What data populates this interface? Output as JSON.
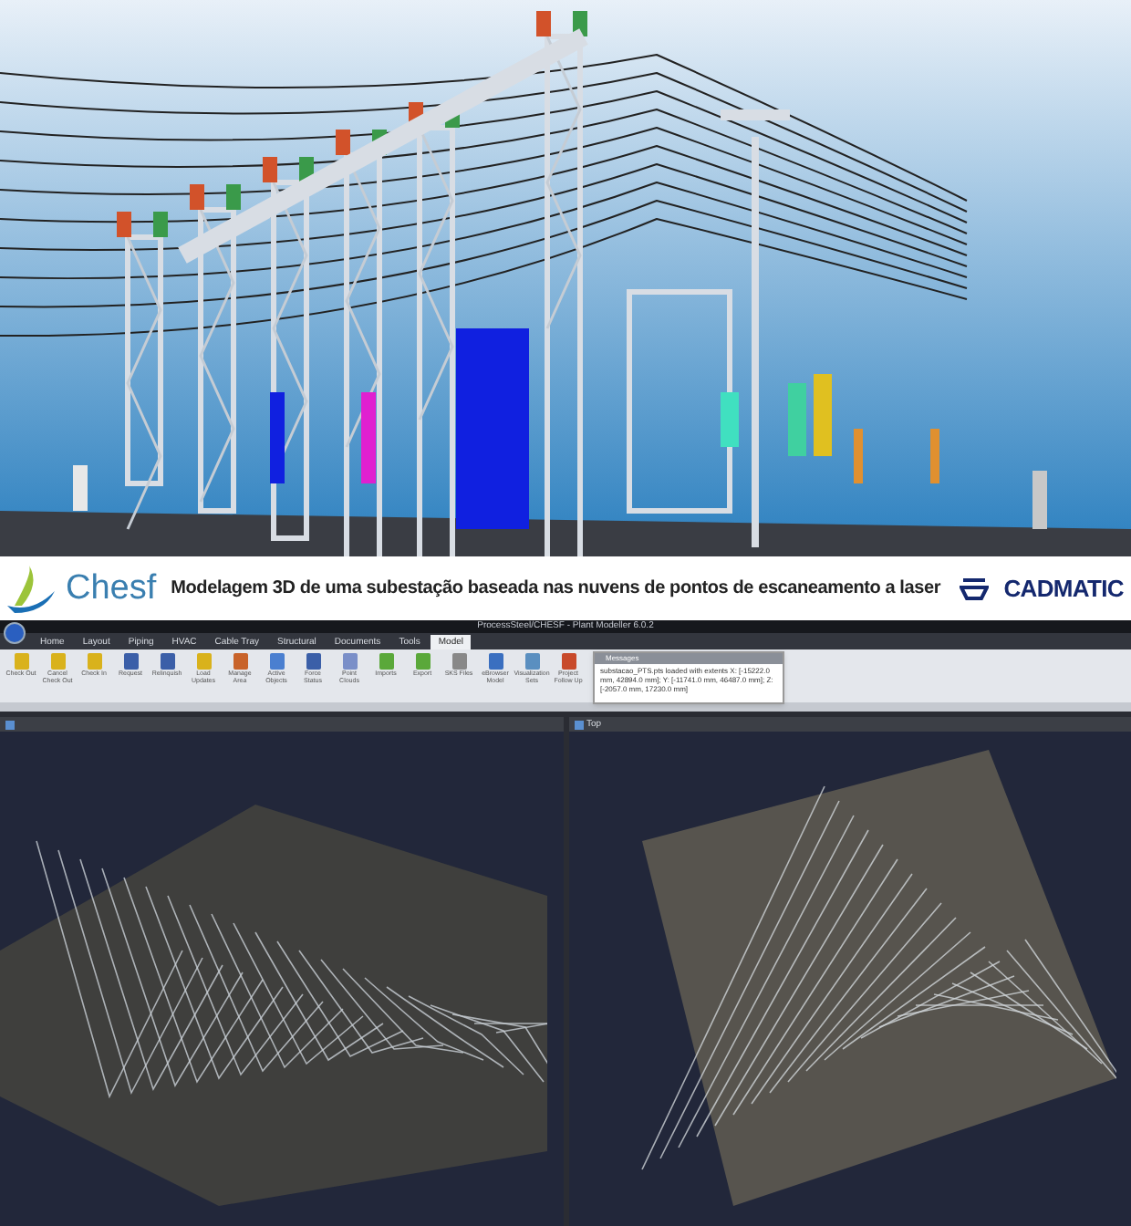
{
  "banner": {
    "brand_left": "Chesf",
    "caption": "Modelagem 3D de uma subestação baseada nas nuvens de pontos de escaneamento a laser",
    "brand_right": "CADMATIC"
  },
  "app": {
    "title": "ProcessSteel/CHESF - Plant Modeller 6.0.2",
    "tabs": [
      {
        "label": "Home",
        "selected": false
      },
      {
        "label": "Layout",
        "selected": false
      },
      {
        "label": "Piping",
        "selected": false
      },
      {
        "label": "HVAC",
        "selected": false
      },
      {
        "label": "Cable Tray",
        "selected": false
      },
      {
        "label": "Structural",
        "selected": false
      },
      {
        "label": "Documents",
        "selected": false
      },
      {
        "label": "Tools",
        "selected": false
      },
      {
        "label": "Model",
        "selected": true
      }
    ],
    "ribbon_buttons": [
      {
        "label": "Check Out"
      },
      {
        "label": "Cancel Check Out"
      },
      {
        "label": "Check In"
      },
      {
        "label": "Request"
      },
      {
        "label": "Relinquish"
      },
      {
        "label": "Load Updates"
      },
      {
        "label": "Manage Area"
      },
      {
        "label": "Active Objects"
      },
      {
        "label": "Force Status"
      },
      {
        "label": "Point Clouds"
      },
      {
        "label": "Imports"
      },
      {
        "label": "Export"
      },
      {
        "label": "SKS Files"
      },
      {
        "label": "eBrowser Model"
      },
      {
        "label": "Visualization Sets"
      },
      {
        "label": "Project Follow Up"
      }
    ],
    "messages": {
      "title": "Messages",
      "text": "substacao_PTS.pts loaded with extents X: [-15222.0 mm, 42894.0 mm]; Y: [-11741.0 mm, 46487.0 mm]; Z: [-2057.0 mm, 17230.0 mm]"
    },
    "viewport_title": "Top"
  }
}
